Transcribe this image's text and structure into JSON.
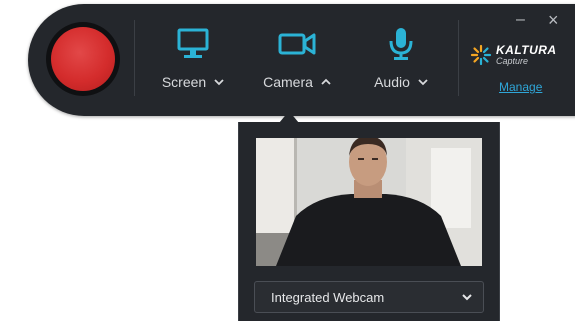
{
  "toolbar": {
    "record_button": "record",
    "sources": [
      {
        "label": "Screen",
        "icon": "monitor-icon",
        "chevron": "down"
      },
      {
        "label": "Camera",
        "icon": "video-camera-icon",
        "chevron": "up"
      },
      {
        "label": "Audio",
        "icon": "microphone-icon",
        "chevron": "down"
      }
    ],
    "window_controls": {
      "minimize": "–",
      "close": "×"
    }
  },
  "brand": {
    "name": "KALTURA",
    "product": "Capture",
    "manage_link": "Manage"
  },
  "camera_panel": {
    "selected_device": "Integrated Webcam"
  },
  "colors": {
    "background": "#24272c",
    "accent_icon": "#2bb3d6",
    "record": "#d42c2c",
    "link": "#2fa6d8"
  }
}
